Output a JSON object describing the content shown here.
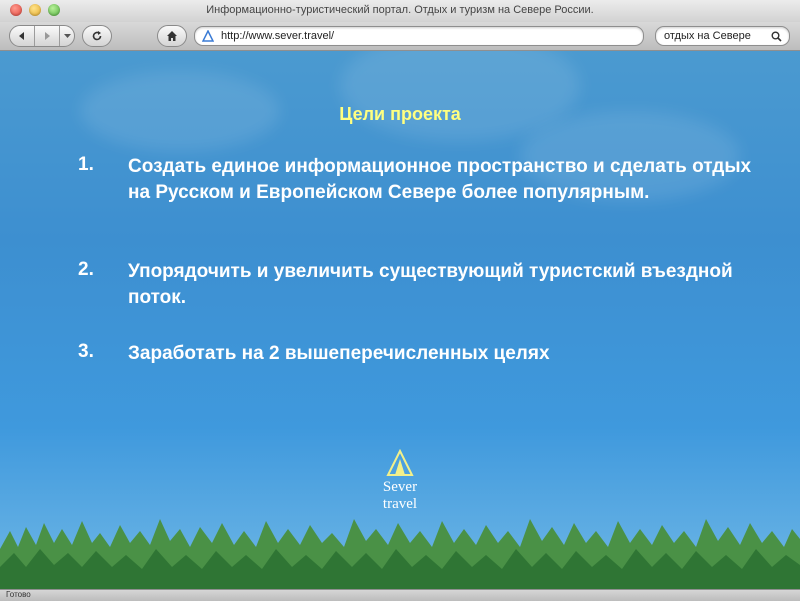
{
  "window": {
    "title": "Информационно-туристический портал. Отдых и туризм на Севере России."
  },
  "toolbar": {
    "url": "http://www.sever.travel/",
    "search_value": "отдых на Севере"
  },
  "page": {
    "heading": "Цели  проекта",
    "goals": [
      {
        "number": "1.",
        "text": "Создать единое информационное пространство и сделать отдых на Русском и Европейском Севере более популярным."
      },
      {
        "number": "2.",
        "text": "Упорядочить и увеличить существующий туристский въездной поток."
      },
      {
        "number": "3.",
        "text": "Заработать на 2 вышеперечисленных целях"
      }
    ],
    "logo": {
      "line1": "Sever",
      "line2": "travel"
    }
  },
  "status": {
    "text": "Готово"
  },
  "colors": {
    "heading": "#ffff80",
    "sky_top": "#4b9ad0",
    "sky_bottom": "#6fb7e6",
    "trees": "#3f8a3a"
  }
}
